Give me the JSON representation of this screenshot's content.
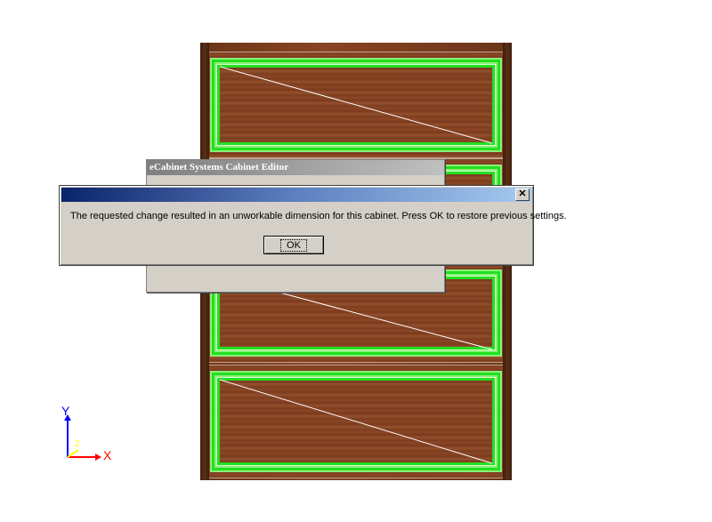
{
  "background_window": {
    "title": "eCabinet Systems Cabinet Editor"
  },
  "dialog": {
    "message": "The requested change resulted in an unworkable dimension for this cabinet.  Press OK to restore previous settings.",
    "ok_label": "OK",
    "close_label": "✕"
  },
  "axes": {
    "x_label": "X",
    "y_label": "Y",
    "z_label": "Z",
    "x_color": "#ff0000",
    "y_color": "#0000ff",
    "z_color": "#ffff00"
  },
  "colors": {
    "highlight": "#22e020",
    "wood": "#7c3e1e",
    "dialog_title_start": "#0a246a",
    "dialog_title_end": "#a6caf0"
  }
}
